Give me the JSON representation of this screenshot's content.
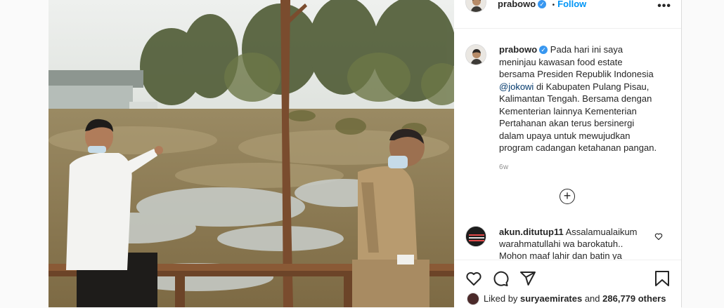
{
  "post": {
    "author": "prabowo",
    "follow_label": "Follow",
    "separator": "•",
    "more_label": "•••"
  },
  "caption": {
    "author": "prabowo",
    "line1": "Pada hari ini saya",
    "line2": "meninjau kawasan food estate",
    "line3": "bersama Presiden Republik Indonesia",
    "mention": "@jokowi",
    "line4_rest": " di Kabupaten Pulang Pisau,",
    "line5": "Kalimantan Tengah. Bersama dengan",
    "line6": "Kementerian lainnya Kementerian",
    "line7": "Pertahanan akan terus bersinergi",
    "line8": "dalam upaya untuk mewujudkan",
    "line9": "program cadangan ketahanan pangan.",
    "time": "6w"
  },
  "comment": {
    "author": "akun.ditutup11",
    "line1": "Assalamualaikum",
    "line2": "warahmatullahi wa barokatuh..",
    "line3": "Mohon maaf lahir dan batin ya"
  },
  "likes": {
    "prefix": "Liked by ",
    "user": "suryaemirates",
    "middle": " and ",
    "count": "286,779 others"
  },
  "colors": {
    "link": "#0095f6",
    "mention": "#00376b",
    "verified": "#3897f0"
  }
}
